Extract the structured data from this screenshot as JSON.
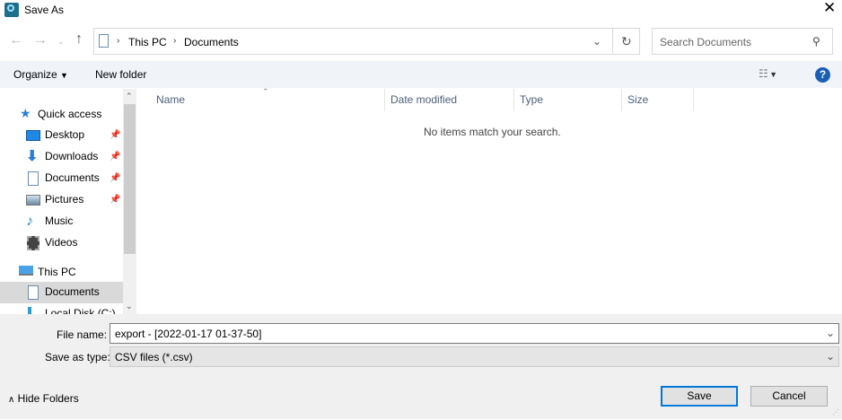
{
  "window": {
    "title": "Save As",
    "close_icon": "close-icon"
  },
  "address": {
    "segments": [
      "This PC",
      "Documents"
    ],
    "search_placeholder": "Search Documents"
  },
  "toolbar": {
    "organize": "Organize",
    "new_folder": "New folder"
  },
  "nav": {
    "quick_access": "Quick access",
    "items": [
      {
        "label": "Desktop",
        "pinned": true
      },
      {
        "label": "Downloads",
        "pinned": true
      },
      {
        "label": "Documents",
        "pinned": true
      },
      {
        "label": "Pictures",
        "pinned": true
      },
      {
        "label": "Music"
      },
      {
        "label": "Videos"
      }
    ],
    "this_pc": "This PC",
    "pc_items": [
      {
        "label": "Documents",
        "selected": true
      },
      {
        "label": "Local Disk (C:)"
      }
    ]
  },
  "columns": [
    "Name",
    "Date modified",
    "Type",
    "Size"
  ],
  "empty_message": "No items match your search.",
  "form": {
    "file_name_label": "File name:",
    "file_name_value": "export - [2022-01-17 01-37-50]",
    "type_label": "Save as type:",
    "type_value": "CSV files (*.csv)"
  },
  "footer": {
    "hide_folders": "Hide Folders",
    "save": "Save",
    "cancel": "Cancel"
  },
  "colors": {
    "accent": "#0078d7",
    "help": "#1a5fb4",
    "selected": "#d9d9d9"
  }
}
